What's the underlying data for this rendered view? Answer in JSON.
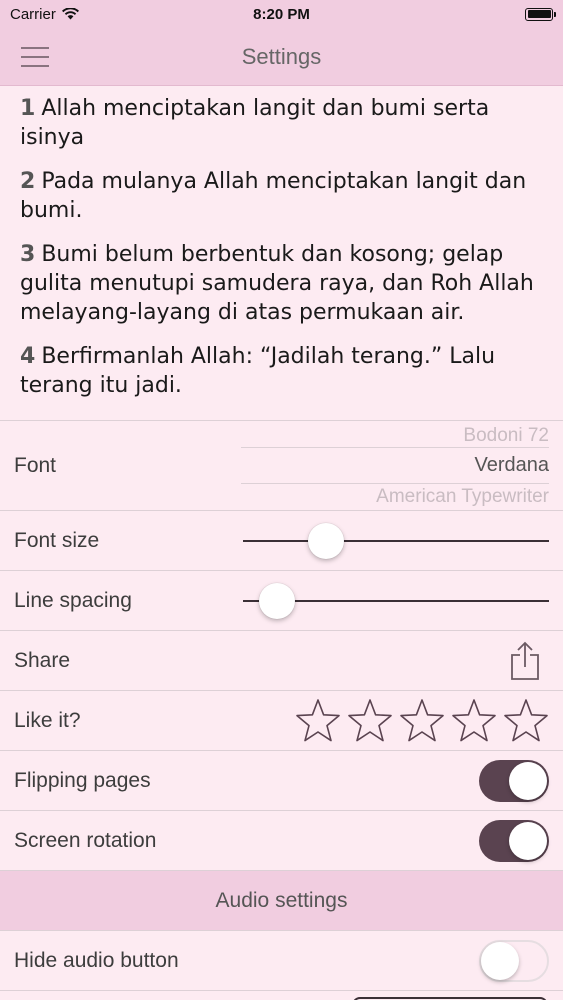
{
  "status_bar": {
    "carrier": "Carrier",
    "time": "8:20 PM",
    "battery_level": 1.0
  },
  "nav": {
    "title": "Settings"
  },
  "verses": [
    {
      "num": "1",
      "text": "Allah menciptakan langit dan bumi serta isinya"
    },
    {
      "num": "2",
      "text": "Pada mulanya Allah menciptakan langit dan bumi."
    },
    {
      "num": "3",
      "text": "Bumi belum berbentuk dan kosong; gelap gulita menutupi samudera raya, dan Roh Allah melayang-layang di atas permukaan air."
    },
    {
      "num": "4",
      "text": "Berfirmanlah Allah: “Jadilah terang.” Lalu terang itu jadi."
    }
  ],
  "settings": {
    "font": {
      "label": "Font",
      "options": [
        "Bodoni 72",
        "Verdana",
        "American Typewriter"
      ],
      "selected": "Verdana"
    },
    "font_size": {
      "label": "Font size",
      "value": 0.24
    },
    "line_spacing": {
      "label": "Line spacing",
      "value": 0.06
    },
    "share": {
      "label": "Share",
      "icon": "share-icon"
    },
    "like": {
      "label": "Like it?",
      "stars_total": 5,
      "stars_filled": 0
    },
    "flipping_pages": {
      "label": "Flipping pages",
      "on": true
    },
    "screen_rotation": {
      "label": "Screen rotation",
      "on": true
    },
    "audio_header": "Audio settings",
    "hide_audio": {
      "label": "Hide audio button",
      "on": false
    }
  },
  "colors": {
    "accent": "#5a4350",
    "bar": "#f1cde0",
    "background": "#fdebf2"
  }
}
